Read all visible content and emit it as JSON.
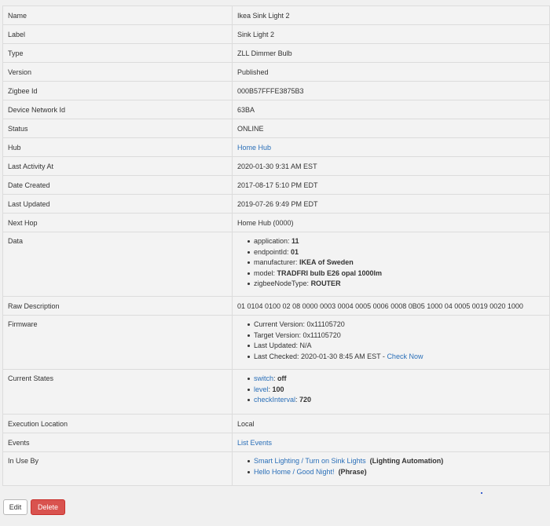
{
  "properties": {
    "name": {
      "label": "Name",
      "value": "Ikea Sink Light 2"
    },
    "label": {
      "label": "Label",
      "value": "Sink Light 2"
    },
    "type": {
      "label": "Type",
      "value": "ZLL Dimmer Bulb"
    },
    "version": {
      "label": "Version",
      "value": "Published"
    },
    "zigbee_id": {
      "label": "Zigbee Id",
      "value": "000B57FFFE3875B3"
    },
    "device_network_id": {
      "label": "Device Network Id",
      "value": "63BA"
    },
    "status": {
      "label": "Status",
      "value": "ONLINE"
    },
    "hub": {
      "label": "Hub",
      "value": "Home Hub"
    },
    "last_activity": {
      "label": "Last Activity At",
      "value": "2020-01-30 9:31 AM EST"
    },
    "date_created": {
      "label": "Date Created",
      "value": "2017-08-17 5:10 PM EDT"
    },
    "last_updated": {
      "label": "Last Updated",
      "value": "2019-07-26 9:49 PM EDT"
    },
    "next_hop": {
      "label": "Next Hop",
      "value": "Home Hub (0000)"
    },
    "data": {
      "label": "Data",
      "items": [
        {
          "key": "application: ",
          "value": "11"
        },
        {
          "key": "endpointId: ",
          "value": "01"
        },
        {
          "key": "manufacturer: ",
          "value": "IKEA of Sweden"
        },
        {
          "key": "model: ",
          "value": "TRADFRI bulb E26 opal 1000lm"
        },
        {
          "key": "zigbeeNodeType: ",
          "value": "ROUTER"
        }
      ]
    },
    "raw_description": {
      "label": "Raw Description",
      "value": "01 0104 0100 02 08 0000 0003 0004 0005 0006 0008 0B05 1000 04 0005 0019 0020 1000"
    },
    "firmware": {
      "label": "Firmware",
      "current_version": "Current Version: 0x11105720",
      "target_version": "Target Version: 0x11105720",
      "last_updated": "Last Updated: N/A",
      "last_checked": "Last Checked: 2020-01-30 8:45 AM EST - ",
      "check_now": "Check Now"
    },
    "current_states": {
      "label": "Current States",
      "items": [
        {
          "name": "switch",
          "value": "off"
        },
        {
          "name": "level",
          "value": "100"
        },
        {
          "name": "checkInterval",
          "value": "720"
        }
      ]
    },
    "execution_location": {
      "label": "Execution Location",
      "value": "Local"
    },
    "events": {
      "label": "Events",
      "value": "List Events"
    },
    "in_use_by": {
      "label": "In Use By",
      "items": [
        {
          "name": "Smart Lighting / Turn on Sink Lights",
          "kind": "(Lighting Automation)"
        },
        {
          "name": "Hello Home / Good Night!",
          "kind": "(Phrase)"
        }
      ]
    }
  },
  "actions": {
    "edit": "Edit",
    "delete": "Delete"
  },
  "colors": {
    "link": "#2a6fb8",
    "delete_bg": "#d9534f",
    "background": "#f0f0f0"
  }
}
